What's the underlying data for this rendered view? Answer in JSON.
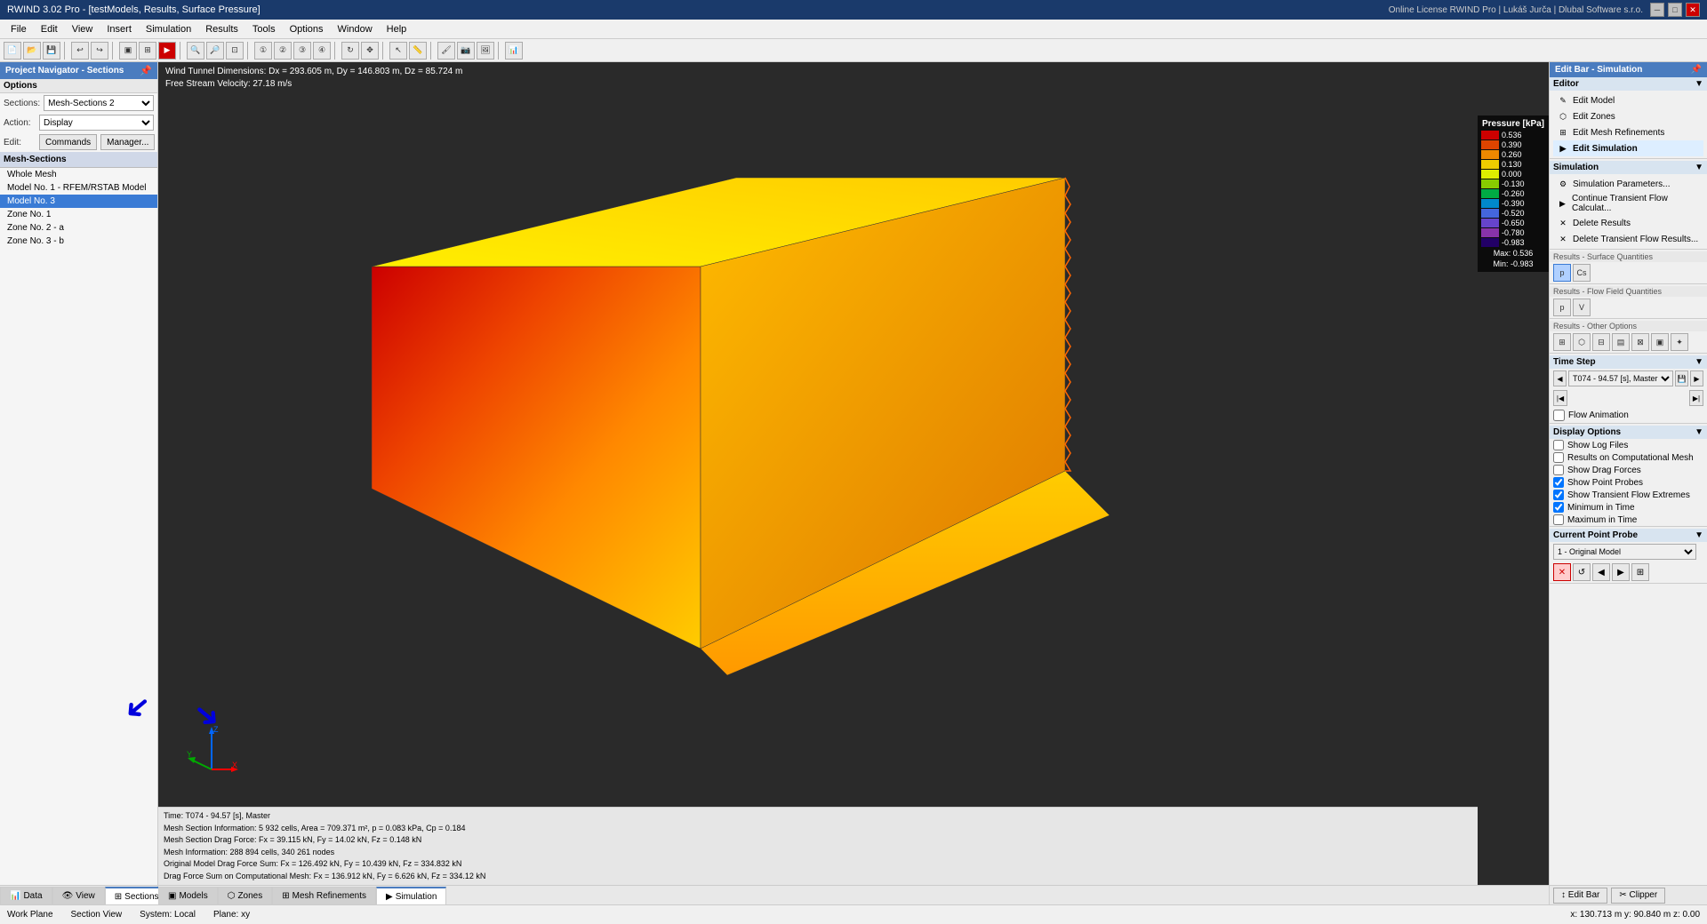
{
  "titlebar": {
    "title": "RWIND 3.02 Pro - [testModels, Results, Surface Pressure]",
    "buttons": [
      "minimize",
      "restore",
      "close"
    ]
  },
  "menubar": {
    "items": [
      "File",
      "Edit",
      "View",
      "Insert",
      "Simulation",
      "Results",
      "Tools",
      "Options",
      "Window",
      "Help"
    ]
  },
  "license_info": "Online License RWIND Pro | Lukáš Jurča | Dlubal Software s.r.o.",
  "left_panel": {
    "title": "Project Navigator - Sections",
    "options_label": "Options",
    "sections_label": "Sections:",
    "sections_value": "Mesh-Sections 2",
    "action_label": "Action:",
    "action_value": "Display",
    "edit_label": "Edit:",
    "commands_btn": "Commands",
    "manager_btn": "Manager...",
    "mesh_sections_label": "Mesh-Sections",
    "mesh_items": [
      {
        "label": "Whole Mesh",
        "selected": false
      },
      {
        "label": "Model No. 1 - RFEM/RSTAB Model",
        "selected": false
      },
      {
        "label": "Model No. 3",
        "selected": true
      },
      {
        "label": "Zone No. 1",
        "selected": false
      },
      {
        "label": "Zone No. 2 - a",
        "selected": false
      },
      {
        "label": "Zone No. 3 - b",
        "selected": false
      }
    ]
  },
  "viewport": {
    "wind_tunnel": "Wind Tunnel Dimensions: Dx = 293.605 m, Dy = 146.803 m, Dz = 85.724 m",
    "free_stream": "Free Stream Velocity: 27.18 m/s",
    "bottom_info": {
      "time": "Time: T074 - 94.57 [s], Master",
      "mesh_section": "Mesh Section Information: 5 932 cells, Area = 709.371 m², p = 0.083 kPa, Cp = 0.184",
      "drag_force": "Mesh Section Drag Force: Fx = 39.115 kN, Fy = 14.02 kN, Fz = 0.148 kN",
      "mesh_info": "Mesh Information: 288 894 cells, 340 261 nodes",
      "original_drag": "Original Model Drag Force Sum: Fx = 126.492 kN, Fy = 10.439 kN, Fz = 334.832 kN",
      "comp_mesh_drag": "Drag Force Sum on Computational Mesh: Fx = 136.912 kN, Fy = 6.626 kN, Fz = 334.12 kN"
    }
  },
  "pressure_legend": {
    "title": "Pressure [kPa]",
    "values": [
      {
        "value": "0.536",
        "color": "#cc0000"
      },
      {
        "value": "0.390",
        "color": "#dd4400"
      },
      {
        "value": "0.260",
        "color": "#ee8800"
      },
      {
        "value": "0.130",
        "color": "#eecc00"
      },
      {
        "value": "0.000",
        "color": "#ddee00"
      },
      {
        "value": "-0.130",
        "color": "#88cc00"
      },
      {
        "value": "-0.260",
        "color": "#00aa44"
      },
      {
        "value": "-0.390",
        "color": "#0088cc"
      },
      {
        "value": "-0.520",
        "color": "#4466dd"
      },
      {
        "value": "-0.650",
        "color": "#6644cc"
      },
      {
        "value": "-0.780",
        "color": "#8833aa"
      },
      {
        "value": "-0.983",
        "color": "#220066"
      }
    ],
    "max_label": "Max:",
    "max_value": "0.536",
    "min_label": "Min:",
    "min_value": "-0.983"
  },
  "right_panel": {
    "edit_bar_title": "Edit Bar - Simulation",
    "editor_label": "Editor",
    "editor_items": [
      {
        "label": "Edit Model",
        "icon": "✎"
      },
      {
        "label": "Edit Zones",
        "icon": "⬡"
      },
      {
        "label": "Edit Mesh Refinements",
        "icon": "⊞"
      },
      {
        "label": "Edit Simulation",
        "icon": "▶",
        "active": true
      }
    ],
    "simulation_label": "Simulation",
    "simulation_items": [
      {
        "label": "Simulation Parameters...",
        "icon": "⚙"
      },
      {
        "label": "Continue Transient Flow Calculat...",
        "icon": "▶"
      },
      {
        "label": "Delete Results",
        "icon": "✕"
      },
      {
        "label": "Delete Transient Flow Results...",
        "icon": "✕"
      }
    ],
    "results_surface_label": "Results - Surface Quantities",
    "surface_btns": [
      "P",
      "Cs"
    ],
    "results_flow_label": "Results - Flow Field Quantities",
    "flow_btns": [
      "P",
      "V"
    ],
    "results_other_label": "Results - Other Options",
    "other_btns": [
      "⊞",
      "⬡",
      "⊟",
      "▤",
      "⊠",
      "▣",
      "✦"
    ],
    "time_step_label": "Time Step",
    "time_step_value": "T074 - 94.57 [s], Master",
    "flow_animation_label": "Flow Animation",
    "flow_animation_checked": false,
    "display_options_label": "Display Options",
    "display_options": [
      {
        "label": "Show Log Files",
        "checked": false
      },
      {
        "label": "Results on Computational Mesh",
        "checked": false
      },
      {
        "label": "Show Drag Forces",
        "checked": false
      },
      {
        "label": "Show Point Probes",
        "checked": true
      },
      {
        "label": "Show Transient Flow Extremes",
        "checked": true
      },
      {
        "label": "Minimum in Time",
        "checked": true
      },
      {
        "label": "Maximum in Time",
        "checked": false
      }
    ],
    "current_point_probe_label": "Current Point Probe",
    "point_probe_value": "1 - Original Model",
    "probe_btns": [
      "✕",
      "↺",
      "◀",
      "▶",
      "⊞"
    ]
  },
  "bottom_tabs": {
    "left_tabs": [
      {
        "label": "Data",
        "icon": "📊",
        "active": false
      },
      {
        "label": "View",
        "icon": "👁",
        "active": false
      },
      {
        "label": "Sections",
        "icon": "⊞",
        "active": true
      }
    ],
    "center_tabs": [
      {
        "label": "Models",
        "icon": "▣",
        "active": false
      },
      {
        "label": "Zones",
        "icon": "⬡",
        "active": false
      },
      {
        "label": "Mesh Refinements",
        "icon": "⊞",
        "active": false
      },
      {
        "label": "Simulation",
        "icon": "▶",
        "active": true
      }
    ]
  },
  "status_bar": {
    "work_plane": "Work Plane",
    "section_view": "Section View",
    "system": "System: Local",
    "plane": "Plane: xy",
    "coordinates": "x: 130.713 m  y: 90.840 m  z: 0.00"
  },
  "edit_bar_bottom": {
    "edit_bar_btn": "↕ Edit Bar",
    "clipper_btn": "✂ Clipper"
  }
}
